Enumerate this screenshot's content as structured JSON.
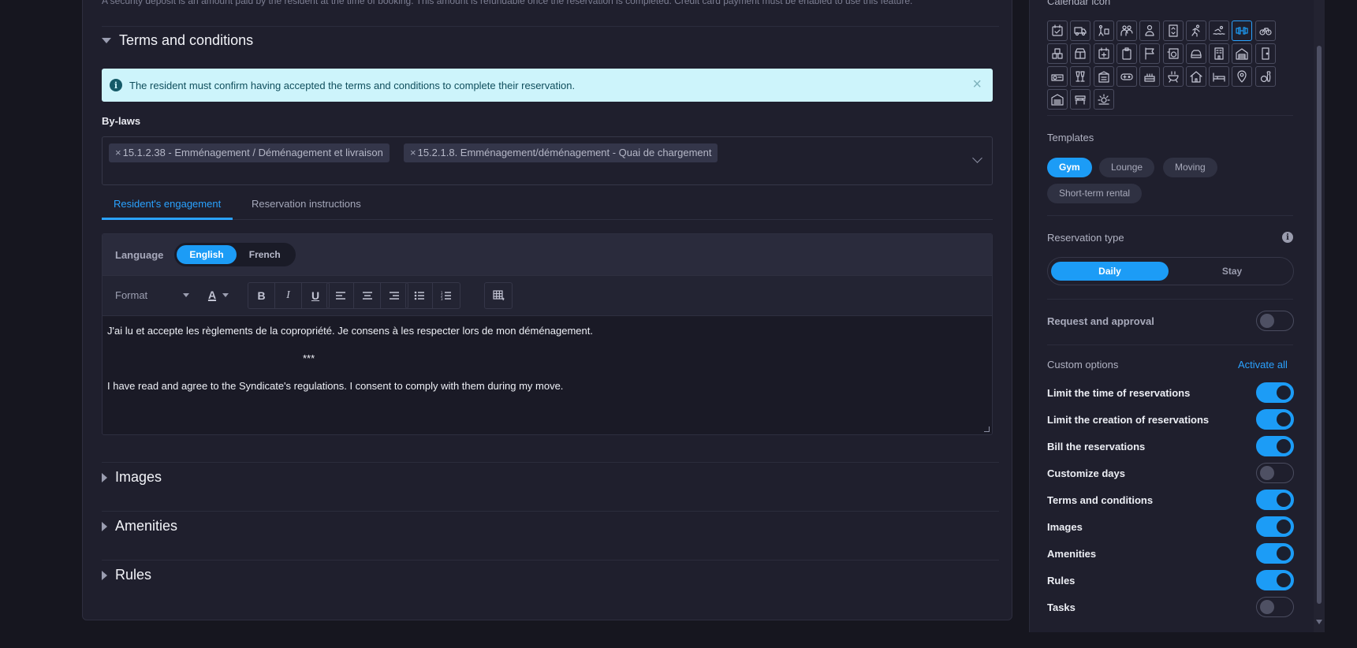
{
  "main": {
    "top_note": "A security deposit is an amount paid by the resident at the time of booking. This amount is refundable once the reservation is completed. Credit card payment must be enabled to use this feature.",
    "terms_section": {
      "title": "Terms and conditions",
      "alert": "The resident must confirm having accepted the terms and conditions to complete their reservation.",
      "bylaws_label": "By-laws",
      "bylaws_chips": [
        "15.1.2.38 - Emménagement / Déménagement et livraison",
        "15.2.1.8. Emménagement/déménagement - Quai de chargement"
      ],
      "chip_remove": "×",
      "tabs": [
        "Resident's engagement",
        "Reservation instructions"
      ],
      "language_label": "Language",
      "languages": [
        "English",
        "French"
      ],
      "format_placeholder": "Format",
      "toolbar": {
        "font_color": "A",
        "bold": "B",
        "italic": "I",
        "underline": "U"
      },
      "editor_lines": [
        "J'ai lu et accepte les règlements de la copropriété. Je consens à les respecter lors de mon déménagement.",
        "***",
        "I have read and agree to the Syndicate's regulations. I consent to comply with them during my move."
      ]
    },
    "collapsed_sections": [
      "Images",
      "Amenities",
      "Rules"
    ]
  },
  "sidebar": {
    "calendar_icon_label": "Calendar icon",
    "selected_icon": "dumbbell-icon",
    "icons": [
      "calendar-check-icon",
      "truck-icon",
      "dolly-icon",
      "people-icon",
      "person-icon",
      "elevator-icon",
      "running-icon",
      "swimming-icon",
      "dumbbell-icon",
      "bicycle-icon",
      "boxes-icon",
      "box-open-icon",
      "calendar-plus-icon",
      "clipboard-icon",
      "flag-icon",
      "washing-icon",
      "car-icon",
      "building-icon",
      "garage-icon",
      "door-icon",
      "projector-icon",
      "cheers-icon",
      "storage-icon",
      "gamepad-icon",
      "cake-icon",
      "bbq-icon",
      "home-icon",
      "bed-icon",
      "map-pin-icon",
      "bowling-icon",
      "parking-garage-icon",
      "bench-icon",
      "sun-icon"
    ],
    "templates_label": "Templates",
    "templates": [
      "Gym",
      "Lounge",
      "Moving",
      "Short-term rental"
    ],
    "active_template": "Gym",
    "reservation_type_label": "Reservation type",
    "reservation_types": [
      "Daily",
      "Stay"
    ],
    "active_reservation_type": "Daily",
    "request_approval_label": "Request and approval",
    "request_approval_on": false,
    "custom_options_label": "Custom options",
    "activate_all": "Activate all",
    "options": [
      {
        "label": "Limit the time of reservations",
        "on": true
      },
      {
        "label": "Limit the creation of reservations",
        "on": true
      },
      {
        "label": "Bill the reservations",
        "on": true
      },
      {
        "label": "Customize days",
        "on": false
      },
      {
        "label": "Terms and conditions",
        "on": true
      },
      {
        "label": "Images",
        "on": true
      },
      {
        "label": "Amenities",
        "on": true
      },
      {
        "label": "Rules",
        "on": true
      },
      {
        "label": "Tasks",
        "on": false
      }
    ],
    "accent_color": "#1c9cf6"
  }
}
